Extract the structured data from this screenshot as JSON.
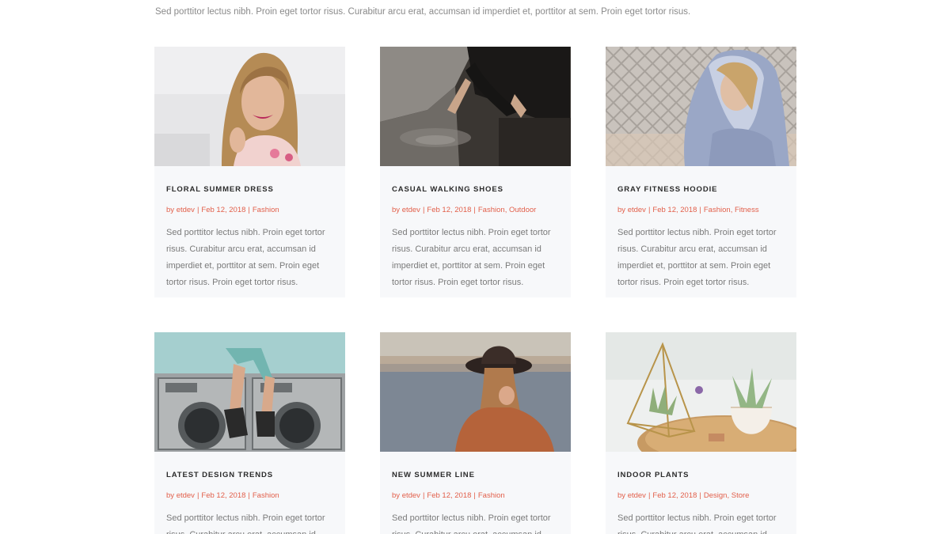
{
  "intro_text": "Sed porttitor lectus nibh. Proin eget tortor risus. Curabitur arcu erat, accumsan id imperdiet et, porttitor at sem. Proin eget tortor risus.",
  "posts": [
    {
      "title": "FLORAL SUMMER DRESS",
      "by": "by",
      "author": "etdev",
      "date": "Feb 12, 2018",
      "categories": [
        "Fashion"
      ],
      "excerpt": "Sed porttitor lectus nibh. Proin eget tortor risus. Curabitur arcu erat, accumsan id imperdiet et, porttitor at sem. Proin eget tortor risus. Proin eget tortor risus.",
      "image": "smiling-woman-photo"
    },
    {
      "title": "CASUAL WALKING SHOES",
      "by": "by",
      "author": "etdev",
      "date": "Feb 12, 2018",
      "categories": [
        "Fashion",
        "Outdoor"
      ],
      "excerpt": "Sed porttitor lectus nibh. Proin eget tortor risus. Curabitur arcu erat, accumsan id imperdiet et, porttitor at sem. Proin eget tortor risus. Proin eget tortor risus.",
      "image": "water-touch-photo"
    },
    {
      "title": "GRAY FITNESS HOODIE",
      "by": "by",
      "author": "etdev",
      "date": "Feb 12, 2018",
      "categories": [
        "Fashion",
        "Fitness"
      ],
      "excerpt": "Sed porttitor lectus nibh. Proin eget tortor risus. Curabitur arcu erat, accumsan id imperdiet et, porttitor at sem. Proin eget tortor risus. Proin eget tortor risus.",
      "image": "hoodie-photo"
    },
    {
      "title": "LATEST DESIGN TRENDS",
      "by": "by",
      "author": "etdev",
      "date": "Feb 12, 2018",
      "categories": [
        "Fashion"
      ],
      "excerpt": "Sed porttitor lectus nibh. Proin eget tortor risus. Curabitur arcu erat, accumsan id",
      "image": "laundromat-photo"
    },
    {
      "title": "NEW SUMMER LINE",
      "by": "by",
      "author": "etdev",
      "date": "Feb 12, 2018",
      "categories": [
        "Fashion"
      ],
      "excerpt": "Sed porttitor lectus nibh. Proin eget tortor risus. Curabitur arcu erat, accumsan id",
      "image": "hat-woman-photo"
    },
    {
      "title": "INDOOR PLANTS",
      "by": "by",
      "author": "etdev",
      "date": "Feb 12, 2018",
      "categories": [
        "Design",
        "Store"
      ],
      "excerpt": "Sed porttitor lectus nibh. Proin eget tortor risus. Curabitur arcu erat, accumsan id",
      "image": "plants-photo"
    }
  ],
  "colors": {
    "accent": "#e25f4a",
    "card_bg": "#f7f8fa",
    "title": "#2b2b2b",
    "body_text": "#7a7a7a"
  }
}
